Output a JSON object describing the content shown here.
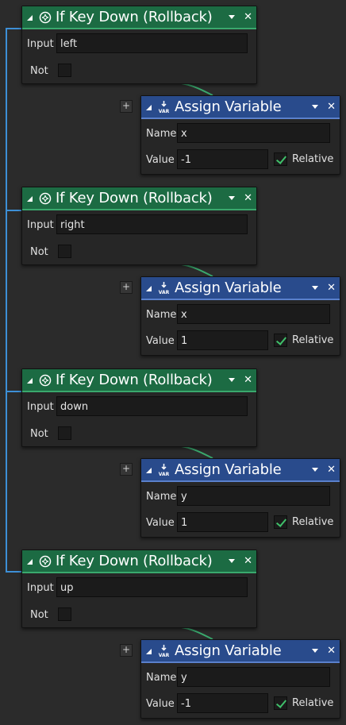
{
  "colors": {
    "if_header": "#1c6b43",
    "var_header": "#294b8c",
    "bracket_line": "#3d8fd6",
    "wire": "#3aa86d",
    "check": "#3fc06a"
  },
  "blocks": [
    {
      "condition": {
        "icon": "gamepad-icon",
        "title": "If Key Down (Rollback)",
        "input_label": "Input",
        "input_value": "left",
        "not_label": "Not",
        "not_checked": false
      },
      "action": {
        "icon": "var-icon",
        "icon_text": "VAR",
        "title": "Assign Variable",
        "name_label": "Name",
        "name_value": "x",
        "value_label": "Value",
        "value_value": "-1",
        "relative_label": "Relative",
        "relative_checked": true
      },
      "add_label": "+"
    },
    {
      "condition": {
        "icon": "gamepad-icon",
        "title": "If Key Down (Rollback)",
        "input_label": "Input",
        "input_value": "right",
        "not_label": "Not",
        "not_checked": false
      },
      "action": {
        "icon": "var-icon",
        "icon_text": "VAR",
        "title": "Assign Variable",
        "name_label": "Name",
        "name_value": "x",
        "value_label": "Value",
        "value_value": "1",
        "relative_label": "Relative",
        "relative_checked": true
      },
      "add_label": "+"
    },
    {
      "condition": {
        "icon": "gamepad-icon",
        "title": "If Key Down (Rollback)",
        "input_label": "Input",
        "input_value": "down",
        "not_label": "Not",
        "not_checked": false
      },
      "action": {
        "icon": "var-icon",
        "icon_text": "VAR",
        "title": "Assign Variable",
        "name_label": "Name",
        "name_value": "y",
        "value_label": "Value",
        "value_value": "1",
        "relative_label": "Relative",
        "relative_checked": true
      },
      "add_label": "+"
    },
    {
      "condition": {
        "icon": "gamepad-icon",
        "title": "If Key Down (Rollback)",
        "input_label": "Input",
        "input_value": "up",
        "not_label": "Not",
        "not_checked": false
      },
      "action": {
        "icon": "var-icon",
        "icon_text": "VAR",
        "title": "Assign Variable",
        "name_label": "Name",
        "name_value": "y",
        "value_label": "Value",
        "value_value": "-1",
        "relative_label": "Relative",
        "relative_checked": true
      },
      "add_label": "+"
    }
  ]
}
